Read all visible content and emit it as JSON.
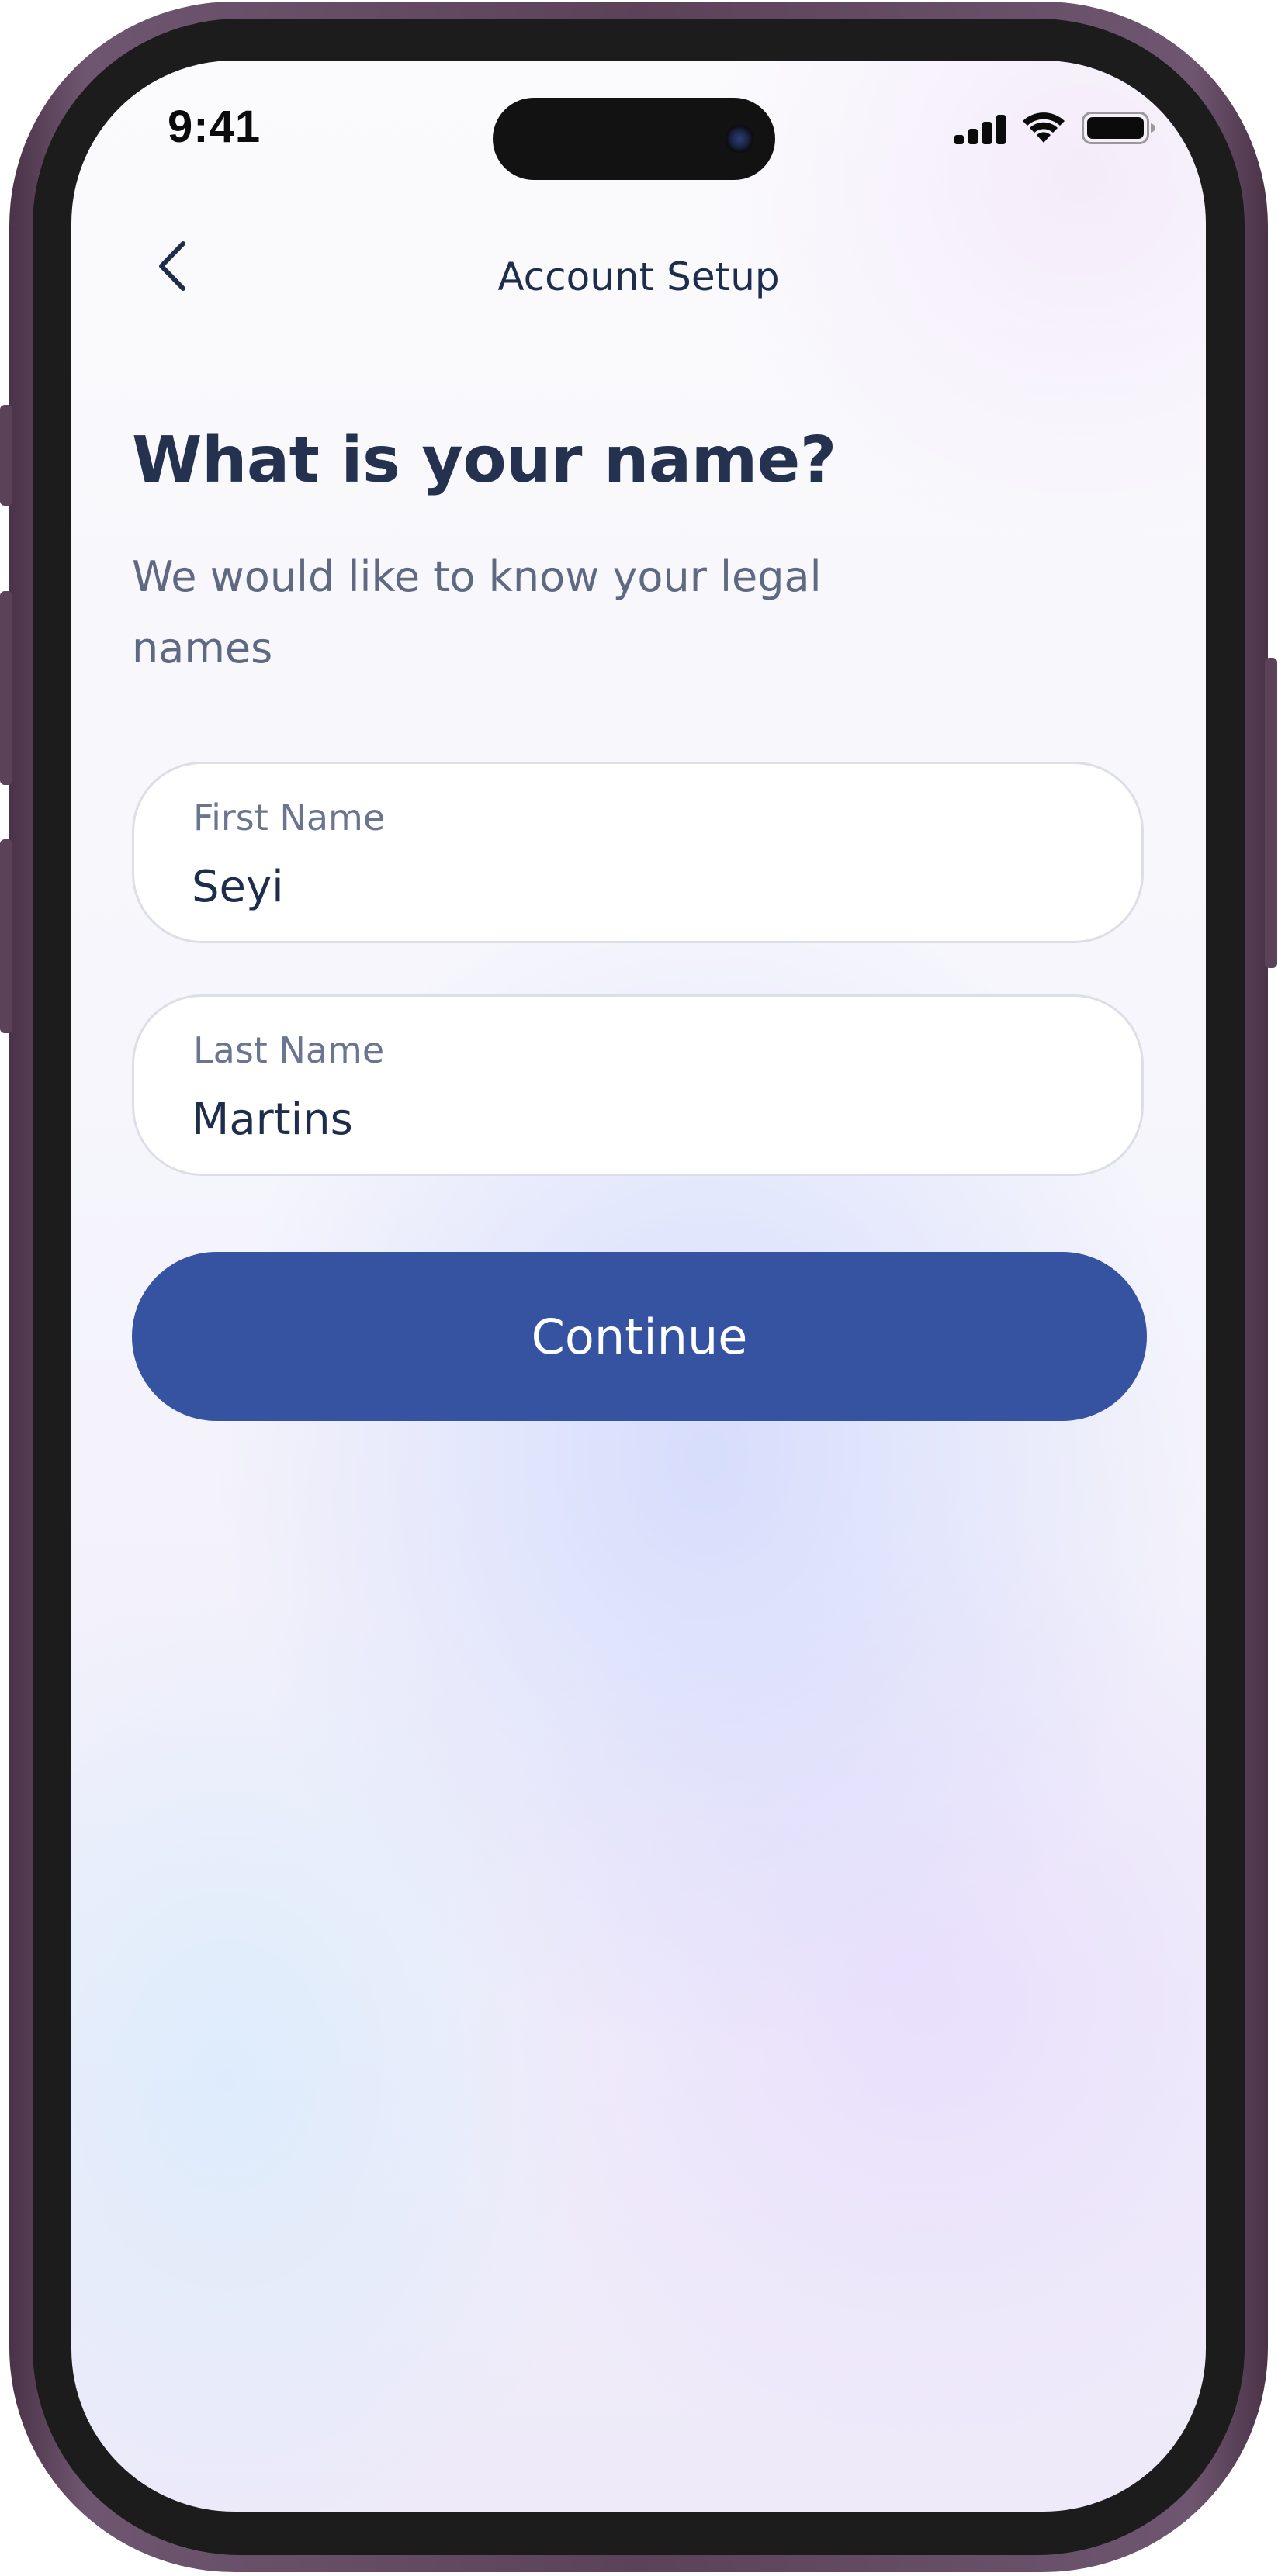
{
  "status_bar": {
    "time": "9:41",
    "icons": [
      "cellular-signal-icon",
      "wifi-icon",
      "battery-icon"
    ]
  },
  "nav": {
    "back_icon": "chevron-left-icon",
    "title": "Account Setup"
  },
  "content": {
    "heading": "What is your name?",
    "subheading": "We would like to know your legal names"
  },
  "form": {
    "first_name": {
      "label": "First Name",
      "value": "Seyi"
    },
    "last_name": {
      "label": "Last Name",
      "value": "Martins"
    }
  },
  "actions": {
    "continue_label": "Continue"
  },
  "colors": {
    "primary": "#3653a1",
    "text_dark": "#24314f",
    "text_muted": "#5f6a82",
    "field_border": "#dcdfe6",
    "phone_frame": "#5b4259"
  }
}
